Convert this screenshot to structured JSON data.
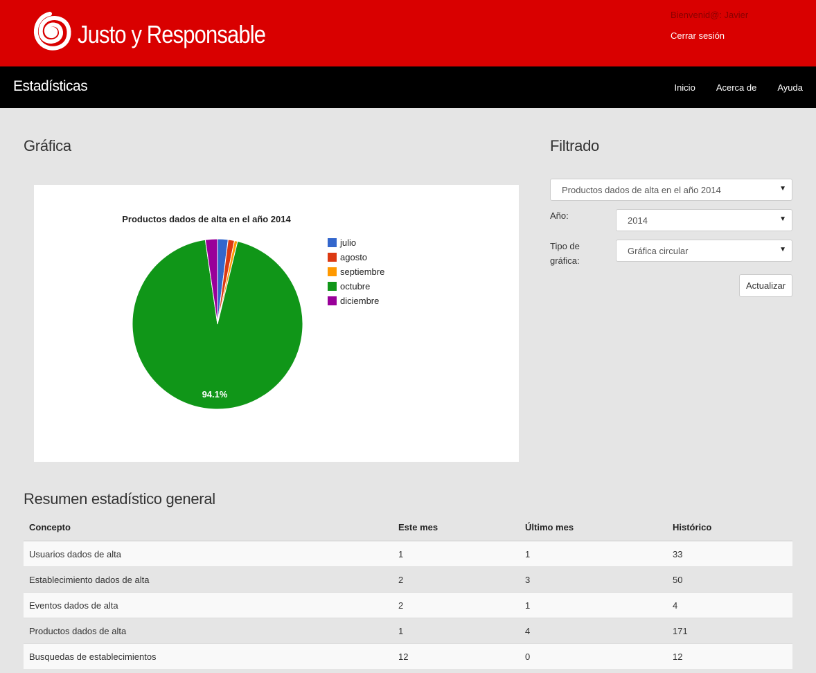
{
  "header": {
    "brand": "Justo y Responsable",
    "welcome": "Bienvenid@: Javier",
    "logout": "Cerrar sesión"
  },
  "nav": {
    "title": "Estadísticas",
    "links": [
      "Inicio",
      "Acerca de",
      "Ayuda"
    ]
  },
  "chart_section": {
    "title": "Gráfica"
  },
  "filter_section": {
    "title": "Filtrado",
    "metric_select": "Productos dados de alta en el año 2014",
    "year_label": "Año:",
    "year_select": "2014",
    "type_label_line1": "Tipo de",
    "type_label_line2": "gráfica:",
    "type_select": "Gráfica circular",
    "update_button": "Actualizar"
  },
  "chart_data": {
    "type": "pie",
    "title": "Productos dados de alta en el año 2014",
    "legend_position": "right",
    "slices": [
      {
        "name": "julio",
        "value": 2.0,
        "color": "#3366cc"
      },
      {
        "name": "agosto",
        "value": 1.2,
        "color": "#dc3912"
      },
      {
        "name": "septiembre",
        "value": 0.6,
        "color": "#ff9900"
      },
      {
        "name": "octubre",
        "value": 94.1,
        "color": "#109618"
      },
      {
        "name": "diciembre",
        "value": 2.3,
        "color": "#990099"
      }
    ],
    "slice_label": "94.1%"
  },
  "summary": {
    "title": "Resumen estadístico general",
    "columns": [
      "Concepto",
      "Este mes",
      "Último mes",
      "Histórico"
    ],
    "rows": [
      [
        "Usuarios dados de alta",
        "1",
        "1",
        "33"
      ],
      [
        "Establecimiento dados de alta",
        "2",
        "3",
        "50"
      ],
      [
        "Eventos dados de alta",
        "2",
        "1",
        "4"
      ],
      [
        "Productos dados de alta",
        "1",
        "4",
        "171"
      ],
      [
        "Busquedas de establecimientos",
        "12",
        "0",
        "12"
      ]
    ]
  }
}
